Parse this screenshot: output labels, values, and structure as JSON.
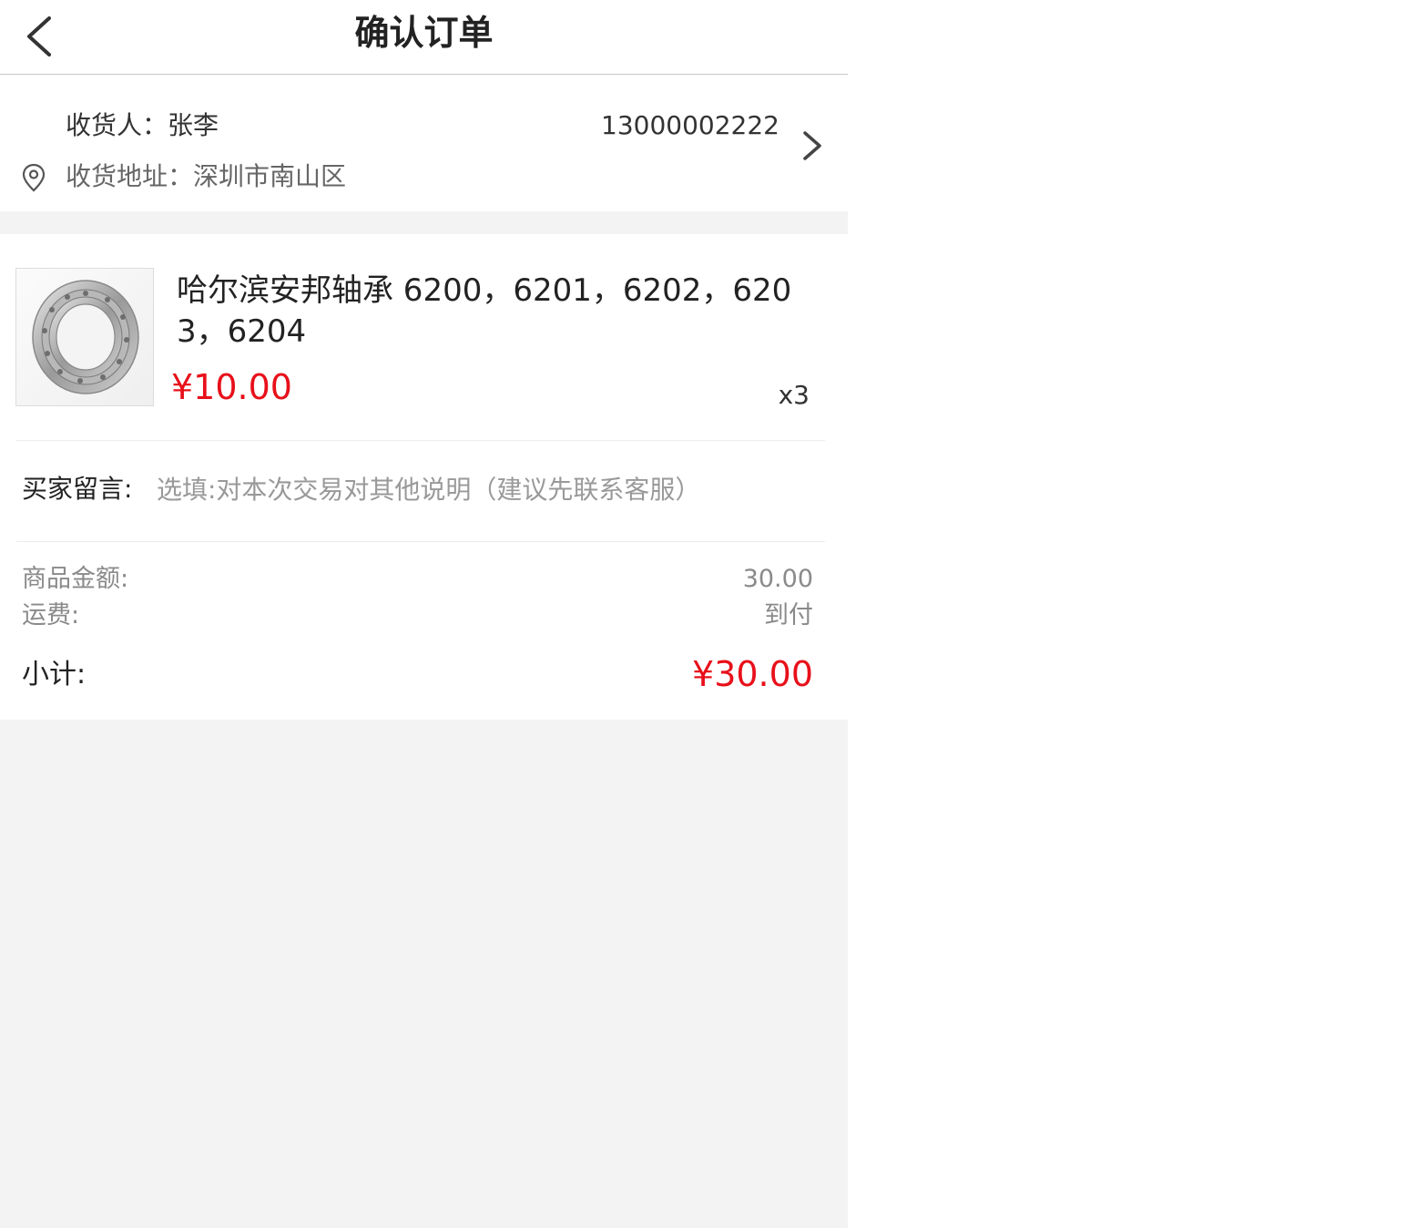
{
  "header": {
    "title": "确认订单"
  },
  "address": {
    "receiver": "收货人：张李",
    "phone": "13000002222",
    "address": "收货地址：深圳市南山区"
  },
  "product": {
    "name": "哈尔滨安邦轴承 6200，6201，6202，6203，6204",
    "price": "¥10.00",
    "quantity": "x3"
  },
  "message": {
    "label": "买家留言:",
    "placeholder": "选填:对本次交易对其他说明（建议先联系客服）"
  },
  "summary": {
    "goods_amount_label": "商品金额:",
    "goods_amount_value": "30.00",
    "shipping_label": "运费:",
    "shipping_value": "到付",
    "subtotal_label": "小计:",
    "subtotal_value": "¥30.00"
  },
  "colors": {
    "accent": "#e8101a",
    "background": "#f3f3f3"
  }
}
